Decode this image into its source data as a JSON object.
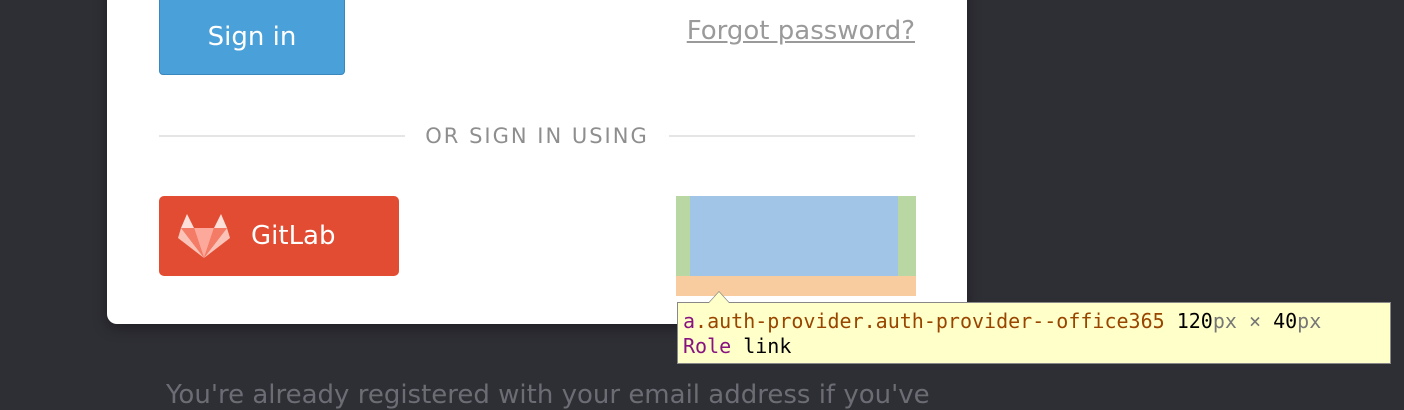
{
  "login": {
    "signin_label": "Sign in",
    "forgot_label": "Forgot password?",
    "divider_label": "OR SIGN IN USING",
    "gitlab_label": "GitLab"
  },
  "devtools": {
    "tag": "a",
    "classes": ".auth-provider.auth-provider--office365",
    "width_value": "120",
    "height_value": "40",
    "unit": "px",
    "times": "×",
    "role_key": "Role",
    "role_value": "link"
  },
  "footer": {
    "registered_text": "You're already registered with your email address if you've"
  },
  "colors": {
    "background": "#2e2e35",
    "signin": "#4aa0d8",
    "gitlab": "#e24c32"
  },
  "icons": {
    "gitlab": "gitlab-fox-icon"
  }
}
